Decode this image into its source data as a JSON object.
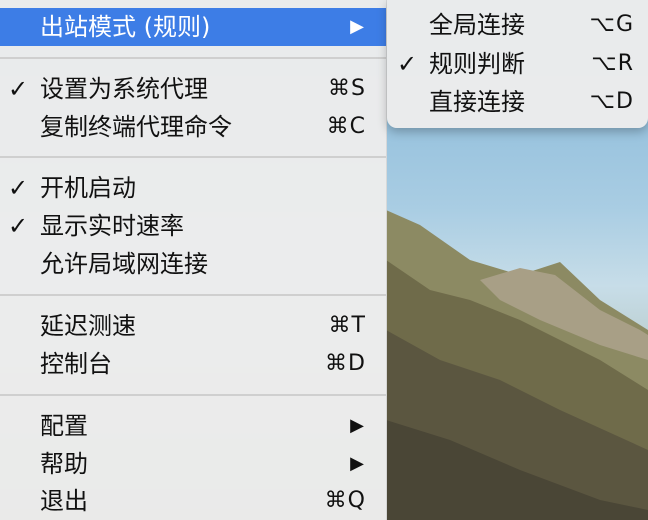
{
  "menu": {
    "items": [
      {
        "label": "出站模式 (规则)",
        "check": "",
        "shortcut": "",
        "arrow": "▶"
      },
      {
        "label": "设置为系统代理",
        "check": "✓",
        "shortcut": "⌘S",
        "arrow": ""
      },
      {
        "label": "复制终端代理命令",
        "check": "",
        "shortcut": "⌘C",
        "arrow": ""
      },
      {
        "label": "开机启动",
        "check": "✓",
        "shortcut": "",
        "arrow": ""
      },
      {
        "label": "显示实时速率",
        "check": "✓",
        "shortcut": "",
        "arrow": ""
      },
      {
        "label": "允许局域网连接",
        "check": "",
        "shortcut": "",
        "arrow": ""
      },
      {
        "label": "延迟测速",
        "check": "",
        "shortcut": "⌘T",
        "arrow": ""
      },
      {
        "label": "控制台",
        "check": "",
        "shortcut": "⌘D",
        "arrow": ""
      },
      {
        "label": "配置",
        "check": "",
        "shortcut": "",
        "arrow": "▶"
      },
      {
        "label": "帮助",
        "check": "",
        "shortcut": "",
        "arrow": "▶"
      },
      {
        "label": "退出",
        "check": "",
        "shortcut": "⌘Q",
        "arrow": ""
      }
    ]
  },
  "submenu": {
    "items": [
      {
        "label": "全局连接",
        "check": "",
        "shortcut": "⌥G"
      },
      {
        "label": "规则判断",
        "check": "✓",
        "shortcut": "⌥R"
      },
      {
        "label": "直接连接",
        "check": "",
        "shortcut": "⌥D"
      }
    ]
  },
  "colors": {
    "highlight": "#3d7de6",
    "menu_bg": "#ececec",
    "separator": "#cfcfcf"
  }
}
